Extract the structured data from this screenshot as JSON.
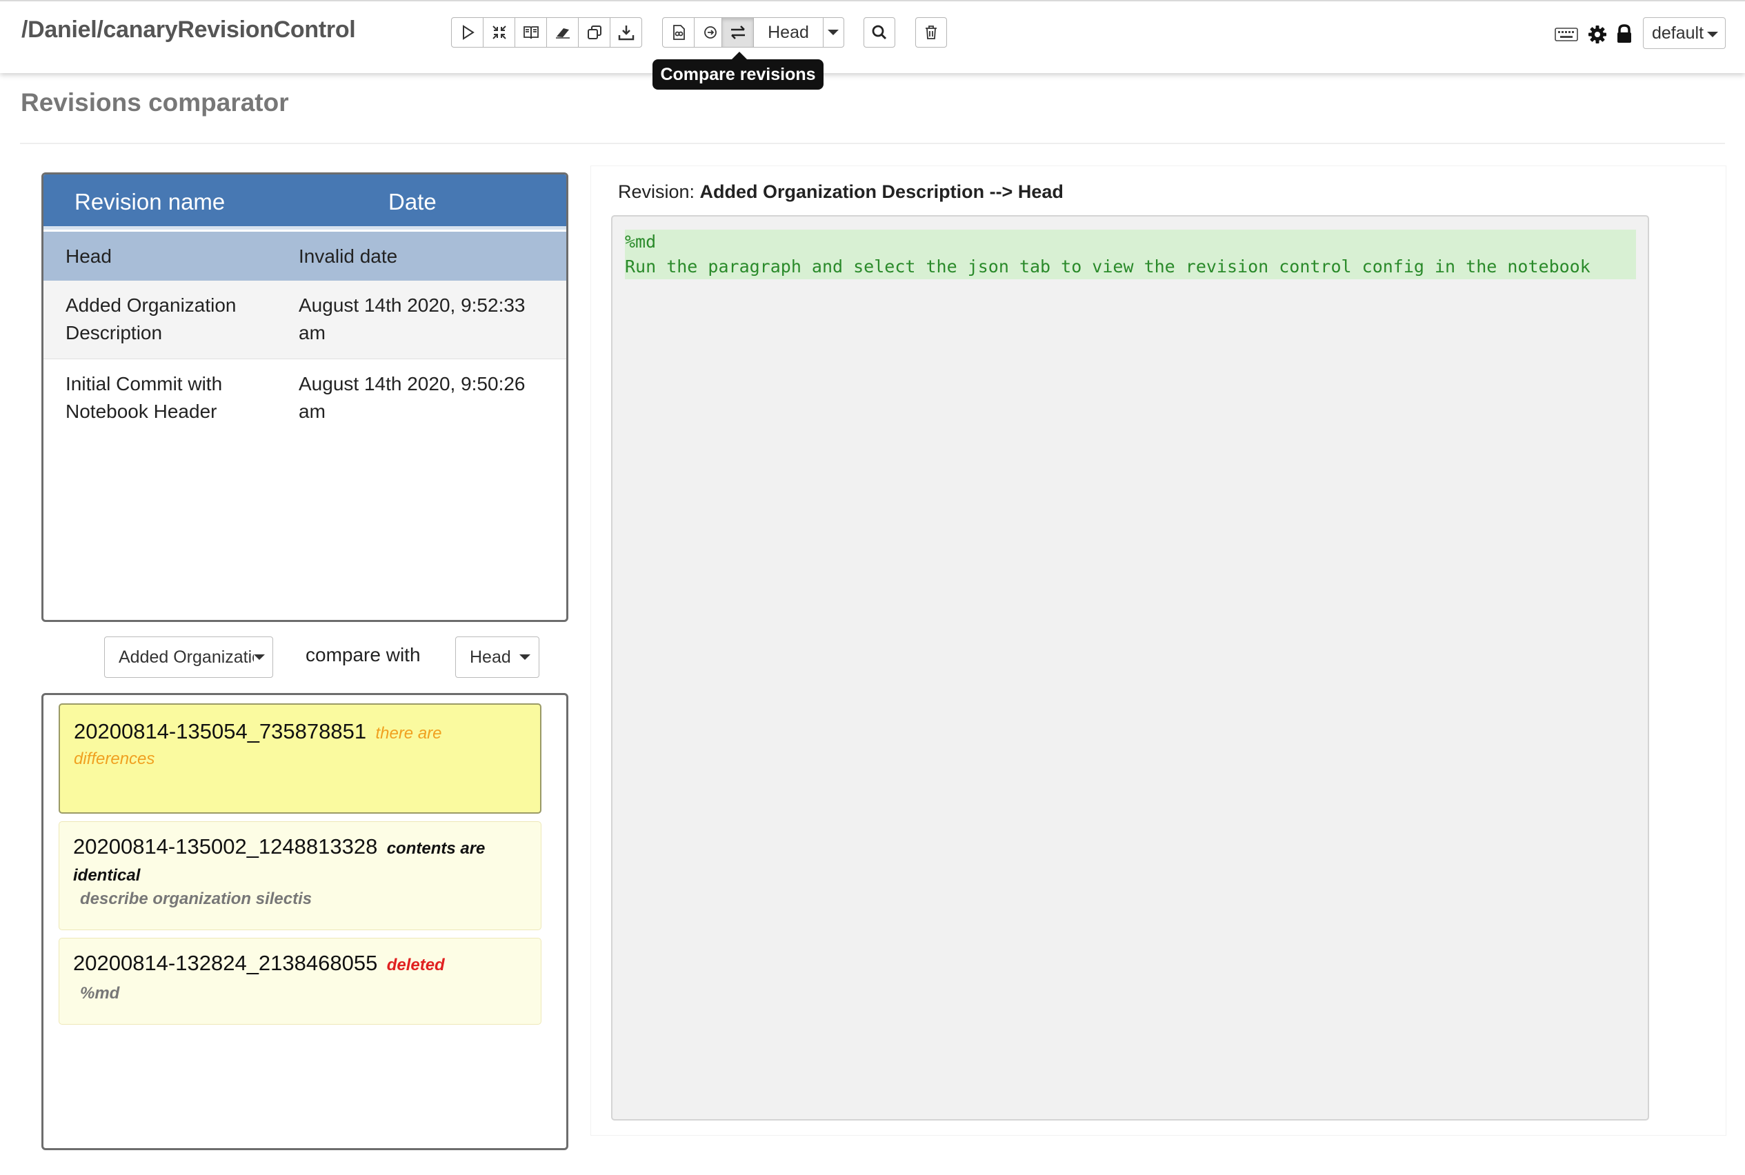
{
  "header": {
    "notebook_title": "/Daniel/canaryRevisionControl",
    "revision_select_value": "Head",
    "tooltip": "Compare revisions",
    "interpreter_label": "default"
  },
  "page": {
    "title": "Revisions comparator"
  },
  "revisions_table": {
    "columns": [
      "Revision name",
      "Date"
    ],
    "rows": [
      {
        "name": "Head",
        "date": "Invalid date"
      },
      {
        "name_line1": "Added Organization",
        "name_line2": "Description",
        "date_line1": "August 14th 2020, 9:52:33",
        "date_line2": "am"
      },
      {
        "name_line1": "Initial Commit with",
        "name_line2": "Notebook Header",
        "date_line1": "August 14th 2020, 9:50:26",
        "date_line2": "am"
      }
    ]
  },
  "compare": {
    "left_value": "Added Organizatio",
    "with_label": "compare with",
    "right_value": "Head"
  },
  "paragraphs": [
    {
      "id": "20200814-135054_735878851",
      "status_a": "there are",
      "status_b": "differences",
      "preview": ""
    },
    {
      "id": "20200814-135002_1248813328",
      "status_a": "contents are",
      "status_b": "identical",
      "preview": "describe organization silectis"
    },
    {
      "id": "20200814-132824_2138468055",
      "status_a": "deleted",
      "status_b": "",
      "preview": "%md"
    }
  ],
  "diff": {
    "revision_prefix": "Revision: ",
    "revision_title": "Added Organization Description --> Head",
    "lines": [
      "%md",
      "Run the paragraph and select the json tab to view the revision control config in the notebook"
    ]
  },
  "colors": {
    "table_header": "#4778b3",
    "selected_row": "#a8bdd7",
    "status_differences": "#f0a020",
    "status_deleted": "#e02020",
    "diff_added_bg": "#d8f0d3",
    "diff_added_text": "#2a8a2a"
  },
  "icons": [
    "run-all-icon",
    "collapse-icon",
    "book-icon",
    "eraser-icon",
    "clone-icon",
    "download-icon",
    "version-control-icon",
    "checkpoint-icon",
    "compare-revisions-icon",
    "search-icon",
    "trash-icon",
    "keyboard-icon",
    "gear-icon",
    "lock-icon"
  ]
}
